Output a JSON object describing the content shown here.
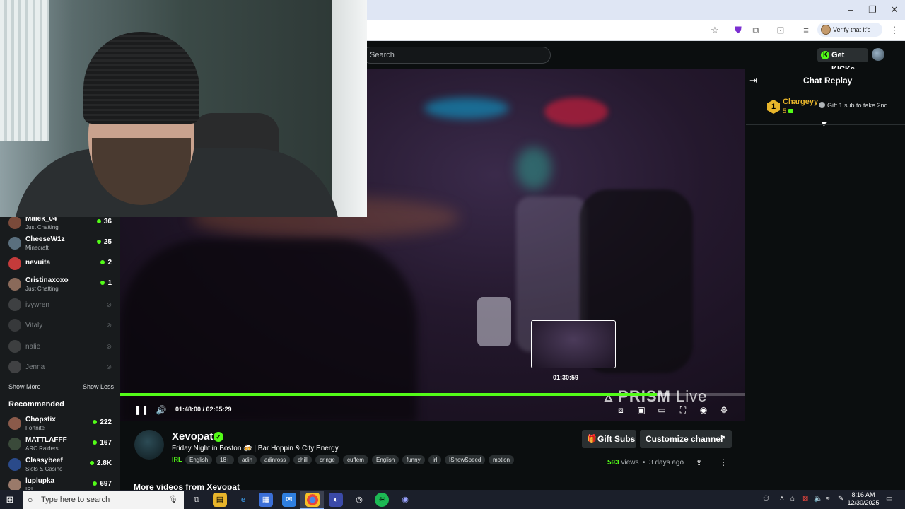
{
  "browser": {
    "window_controls": [
      "–",
      "❐",
      "✕"
    ],
    "verify_label": "Verify that it's you"
  },
  "header": {
    "search_placeholder": "Search",
    "get_kicks_label": "Get KICKs"
  },
  "sidebar": {
    "following": [
      {
        "name": "Malek_04",
        "category": "Just Chatting",
        "viewers": "36",
        "live": true,
        "avatar_color": "#7a4a3a"
      },
      {
        "name": "CheeseW1z",
        "category": "Minecraft",
        "viewers": "25",
        "live": true,
        "avatar_color": "#5a6f7e"
      },
      {
        "name": "nevuita",
        "category": "",
        "viewers": "2",
        "live": true,
        "avatar_color": "#c43b3b"
      },
      {
        "name": "Cristinaxoxo",
        "category": "Just Chatting",
        "viewers": "1",
        "live": true,
        "avatar_color": "#8a6a5a"
      },
      {
        "name": "ivywren",
        "category": "",
        "viewers": "",
        "live": false,
        "avatar_color": "#6d6f70"
      },
      {
        "name": "Vitaly",
        "category": "",
        "viewers": "",
        "live": false,
        "avatar_color": "#5d6061"
      },
      {
        "name": "nalie",
        "category": "",
        "viewers": "",
        "live": false,
        "avatar_color": "#6a6c6d"
      },
      {
        "name": "Jenna",
        "category": "",
        "viewers": "",
        "live": false,
        "avatar_color": "#707273"
      }
    ],
    "show_more": "Show More",
    "show_less": "Show Less",
    "recommended_title": "Recommended",
    "recommended": [
      {
        "name": "Chopstix",
        "category": "Fortnite",
        "viewers": "222",
        "avatar_color": "#8a5a4a"
      },
      {
        "name": "MATTLAFFF",
        "category": "ARC Raiders",
        "viewers": "167",
        "avatar_color": "#3a4a3a"
      },
      {
        "name": "Classybeef",
        "category": "Slots & Casino",
        "viewers": "2.8K",
        "avatar_color": "#2a4a8a"
      },
      {
        "name": "luplupka",
        "category": "IRL",
        "viewers": "697",
        "avatar_color": "#9a7a6a"
      }
    ]
  },
  "player": {
    "time_display": "01:48:00 / 02:05:29",
    "preview_time": "01:30:59",
    "progress": 0.86,
    "buffered": 0.88,
    "watermark_prism": "PRISM",
    "watermark_live": "Live"
  },
  "chat": {
    "title": "Chat Replay",
    "top_gifter_rank": "1",
    "top_gifter_name": "Chargeyy",
    "top_gifter_count": "5",
    "gift_prompt": "Gift 1 sub to take 2nd"
  },
  "channel": {
    "name": "Xevopat",
    "title": "Friday Night in Boston 🍻 | Bar Hoppin & City Energy",
    "category": "IRL",
    "tags": [
      "English",
      "18+",
      "adin",
      "adinross",
      "chill",
      "cringe",
      "cuffem",
      "English",
      "funny",
      "irl",
      "IShowSpeed",
      "motion"
    ],
    "gift_subs_label": "Gift Subs",
    "customize_label": "Customize channel",
    "views_count": "593",
    "views_label": "views",
    "age": "3 days ago",
    "more_videos": "More videos from Xevopat"
  },
  "taskbar": {
    "search_placeholder": "Type here to search",
    "time": "8:16 AM",
    "date": "12/30/2025"
  },
  "colors": {
    "accent": "#53fc18",
    "gold": "#e8b52b",
    "background": "#0b0e0f"
  }
}
